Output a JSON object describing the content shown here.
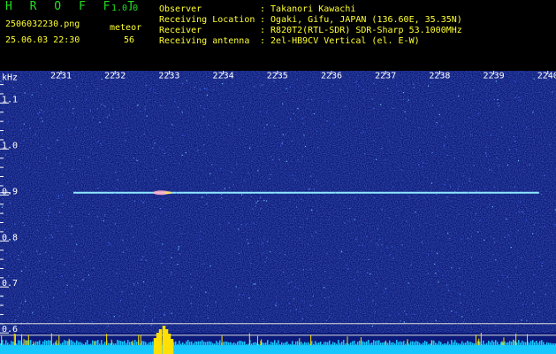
{
  "header": {
    "app_name": "H R O F F T",
    "app_version": "1.0.0",
    "filename": "2506032230.png",
    "datetime": "25.06.03 22:30",
    "detector_label": "meteor",
    "detector_count": "56",
    "info_rows": [
      {
        "label": "Observer",
        "value": ": Takanori Kawachi"
      },
      {
        "label": "Receiving Location",
        "value": ": Ogaki, Gifu, JAPAN (136.60E, 35.35N)"
      },
      {
        "label": "Receiver",
        "value": ": R820T2(RTL-SDR) SDR-Sharp 53.1000MHz"
      },
      {
        "label": "Receiving antenna",
        "value": ": 2el-HB9CV Vertical (el. E-W)"
      }
    ]
  },
  "colors": {
    "header_green": "#22dd22",
    "header_yellow": "#ffff33",
    "background_noise": "#0b1a7a",
    "trace": "#8fe8ff",
    "spectrum_base": "#16c8ff",
    "spectrum_peak": "#ffe000"
  },
  "chart_data": {
    "type": "heatmap",
    "ylabel": "kHz",
    "x_ticks": [
      "2231",
      "2232",
      "2233",
      "2234",
      "2235",
      "2236",
      "2237",
      "2238",
      "2239",
      "2240"
    ],
    "y_ticks": [
      "1.1",
      "1.0",
      "0.9",
      "0.8",
      "0.7",
      "0.6"
    ],
    "ylim": [
      0.585,
      1.17
    ],
    "signals": [
      {
        "kind": "carrier",
        "freq_khz": 0.905,
        "from_min": 2231.0,
        "to_min": 2240.0
      },
      {
        "kind": "meteor_echo",
        "freq_khz": 0.905,
        "at_min": 2232.85
      }
    ],
    "detections": {
      "peak_at_min": 2232.9
    }
  }
}
